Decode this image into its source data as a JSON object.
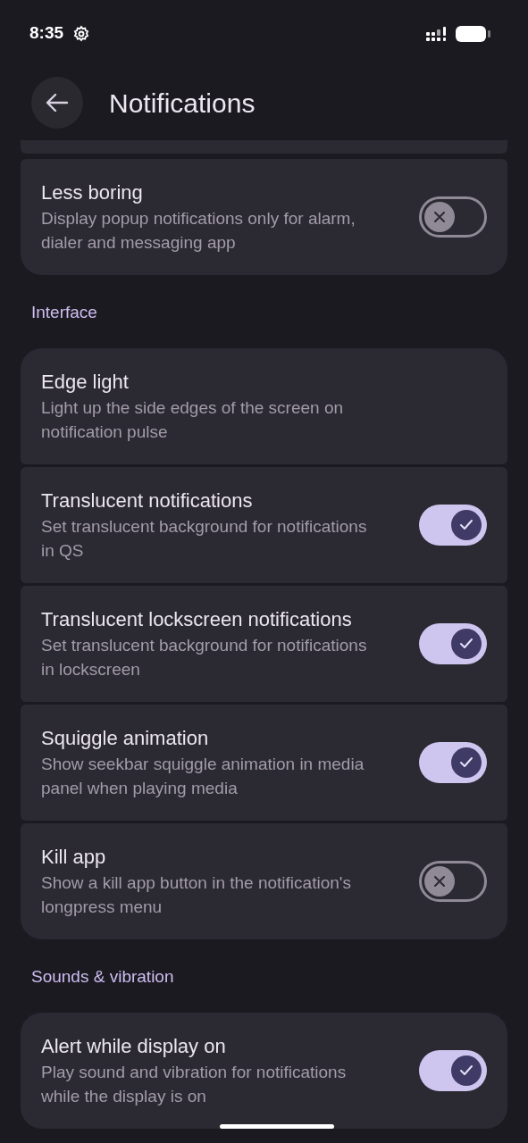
{
  "status_bar": {
    "time": "8:35"
  },
  "header": {
    "title": "Notifications"
  },
  "groups": [
    {
      "items": [
        {
          "kind": "switch",
          "title": "Less boring",
          "summary": "Display popup notifications only for alarm, dialer and messaging app",
          "on": false
        }
      ]
    },
    {
      "header": "Interface",
      "items": [
        {
          "kind": "plain",
          "title": "Edge light",
          "summary": "Light up the side edges of the screen on notification pulse"
        },
        {
          "kind": "switch",
          "title": "Translucent notifications",
          "summary": "Set translucent background for notifications in QS",
          "on": true
        },
        {
          "kind": "switch",
          "title": "Translucent lockscreen notifications",
          "summary": "Set translucent background for notifications in lockscreen",
          "on": true
        },
        {
          "kind": "switch",
          "title": "Squiggle animation",
          "summary": "Show seekbar squiggle animation in media panel when playing media",
          "on": true
        },
        {
          "kind": "switch",
          "title": "Kill app",
          "summary": "Show a kill app button in the notification's longpress menu",
          "on": false
        }
      ]
    },
    {
      "header": "Sounds & vibration",
      "items": [
        {
          "kind": "switch",
          "title": "Alert while display on",
          "summary": "Play sound and vibration for notifications while the display is on",
          "on": true
        }
      ]
    }
  ]
}
